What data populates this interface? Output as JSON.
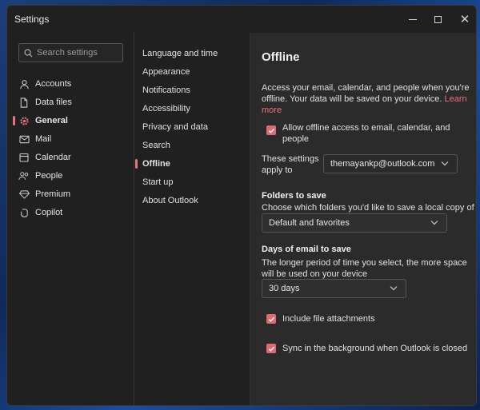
{
  "window": {
    "title": "Settings"
  },
  "search": {
    "placeholder": "Search settings"
  },
  "sidebar": {
    "items": [
      {
        "label": "Accounts",
        "icon": "person-icon"
      },
      {
        "label": "Data files",
        "icon": "file-icon"
      },
      {
        "label": "General",
        "icon": "gear-icon",
        "active": true
      },
      {
        "label": "Mail",
        "icon": "mail-icon"
      },
      {
        "label": "Calendar",
        "icon": "calendar-icon"
      },
      {
        "label": "People",
        "icon": "people-icon"
      },
      {
        "label": "Premium",
        "icon": "diamond-icon"
      },
      {
        "label": "Copilot",
        "icon": "copilot-icon"
      }
    ]
  },
  "general_menu": {
    "items": [
      {
        "label": "Language and time"
      },
      {
        "label": "Appearance"
      },
      {
        "label": "Notifications"
      },
      {
        "label": "Accessibility"
      },
      {
        "label": "Privacy and data"
      },
      {
        "label": "Search"
      },
      {
        "label": "Offline",
        "active": true
      },
      {
        "label": "Start up"
      },
      {
        "label": "About Outlook"
      }
    ]
  },
  "offline": {
    "title": "Offline",
    "description_line1": "Access your email, calendar, and people when you're",
    "description_line2": "offline. Your data will be saved on your device.",
    "learn_more_part1": "Learn",
    "learn_more_part2": "more",
    "allow_offline_line1": "Allow offline access to email, calendar, and",
    "allow_offline_line2": "people",
    "settings_apply_line1": "These settings",
    "settings_apply_line2": "apply to",
    "account_value": "themayankp@outlook.com",
    "folders_title": "Folders to save",
    "folders_desc": "Choose which folders you'd like to save a local copy of",
    "folders_value": "Default and favorites",
    "days_title": "Days of email to save",
    "days_desc_line1": "The longer period of time you select, the more space",
    "days_desc_line2": "will be used on your device",
    "days_value": "30 days",
    "include_attachments": "Include file attachments",
    "sync_background": "Sync in the background when Outlook is closed"
  },
  "colors": {
    "accent": "#e06a72",
    "window_bg": "#202020",
    "content_bg": "#2b2b2b"
  }
}
